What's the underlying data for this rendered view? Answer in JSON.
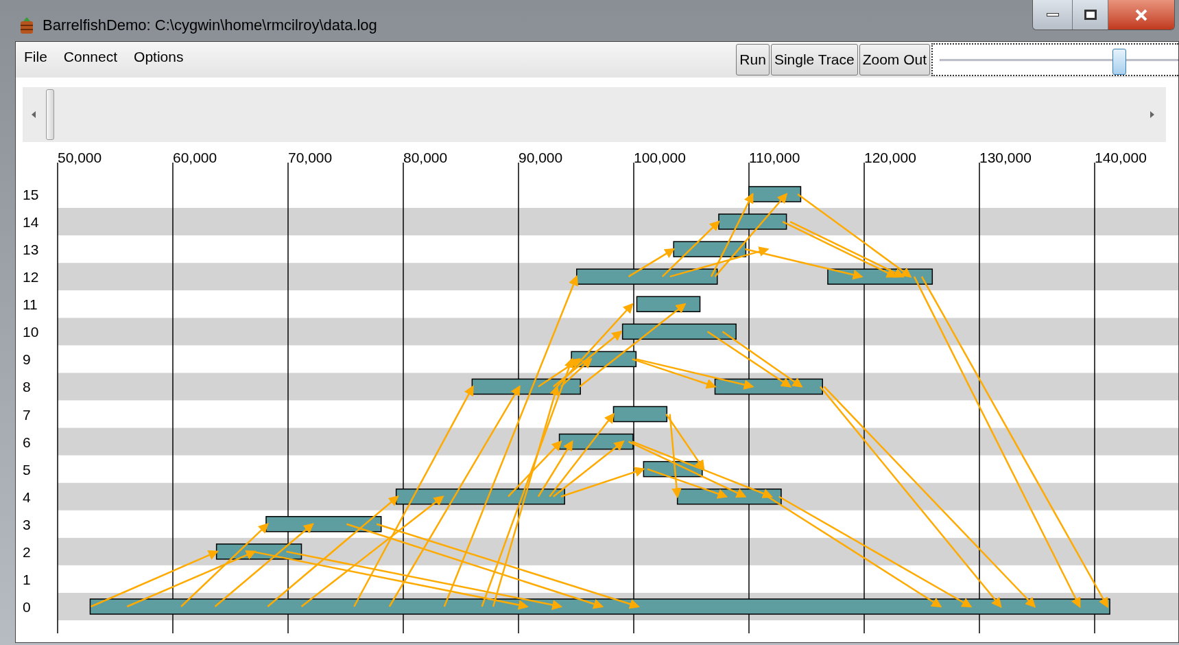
{
  "window": {
    "title": "BarrelfishDemo: C:\\cygwin\\home\\rmcilroy\\data.log"
  },
  "menu": [
    {
      "label": "File"
    },
    {
      "label": "Connect"
    },
    {
      "label": "Options"
    }
  ],
  "toolbar": {
    "buttons": [
      "Run",
      "Single Trace",
      "Zoom Out"
    ],
    "zoom_slider": {
      "level": 0.82
    }
  },
  "timeline": {
    "ticks": [
      "50,000",
      "60,000",
      "70,000",
      "80,000",
      "90,000",
      "100,000",
      "110,000",
      "120,000",
      "130,000",
      "140,000"
    ],
    "lanes": [
      "15",
      "14",
      "13",
      "12",
      "11",
      "10",
      "9",
      "8",
      "7",
      "6",
      "5",
      "4",
      "3",
      "2",
      "1",
      "0"
    ]
  }
}
